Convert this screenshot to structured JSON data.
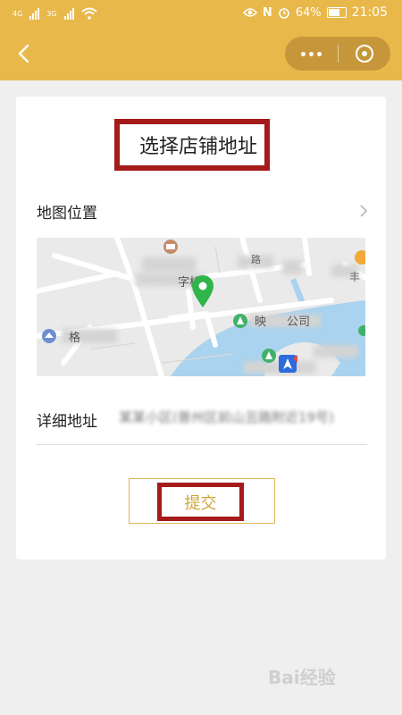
{
  "status_bar": {
    "network_left": "4G",
    "network_right": "3G",
    "battery_percent": "64%",
    "time": "21:05"
  },
  "nav": {
    "back_icon": "chevron-left-icon",
    "more_icon": "more-dots-icon",
    "close_icon": "target-icon"
  },
  "page": {
    "title": "选择店铺地址",
    "map_position_label": "地图位置",
    "detail_address_label": "详细地址",
    "detail_address_value": "某某小区(普州区前山丑路附近19号)",
    "submit_label": "提交"
  },
  "map": {
    "labels": [
      "格",
      "字校",
      "路",
      "丰",
      "映",
      "公司"
    ]
  },
  "watermark": "Bai经验",
  "colors": {
    "header": "#e8b84a",
    "highlight_border": "#a51b1b",
    "submit_text": "#d2a43c",
    "map_water": "#a9d3ef",
    "map_land": "#eaeaea",
    "pin_green": "#2fb54a"
  }
}
